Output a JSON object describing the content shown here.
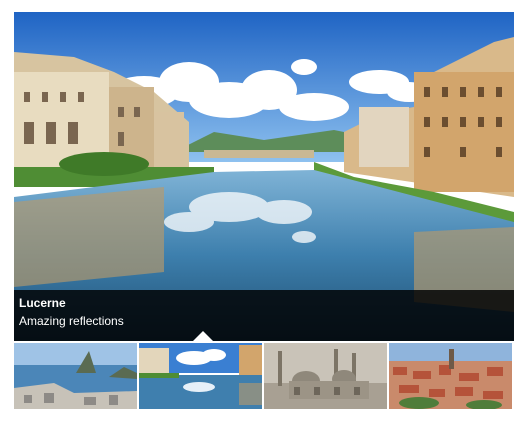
{
  "caption": {
    "title": "Lucerne",
    "text": "Amazing reflections"
  },
  "main_image": {
    "scene": "river-city-reflection"
  },
  "thumbnails": [
    {
      "scene": "coastal-bay"
    },
    {
      "scene": "river-city-reflection",
      "selected": true
    },
    {
      "scene": "mosque-skyline"
    },
    {
      "scene": "red-roof-city"
    }
  ],
  "colors": {
    "caption_background": "#000000",
    "caption_text": "#ffffff",
    "sky": "#2f78d0",
    "water": "#2c6f9e"
  }
}
